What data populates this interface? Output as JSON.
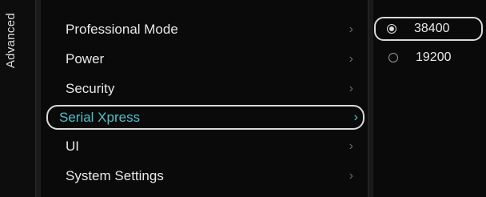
{
  "side_tab": {
    "label": "Advanced"
  },
  "menu": {
    "items": [
      {
        "label": "Professional Mode",
        "selected": false
      },
      {
        "label": "Power",
        "selected": false
      },
      {
        "label": "Security",
        "selected": false
      },
      {
        "label": "Serial Xpress",
        "selected": true
      },
      {
        "label": "UI",
        "selected": false
      },
      {
        "label": "System Settings",
        "selected": false
      }
    ],
    "chevron": "›"
  },
  "options": {
    "items": [
      {
        "value": "38400",
        "checked": true
      },
      {
        "value": "19200",
        "checked": false
      }
    ]
  },
  "colors": {
    "accent": "#4fc1c8",
    "background": "#0a0a0a",
    "text": "#e8e8e8"
  }
}
